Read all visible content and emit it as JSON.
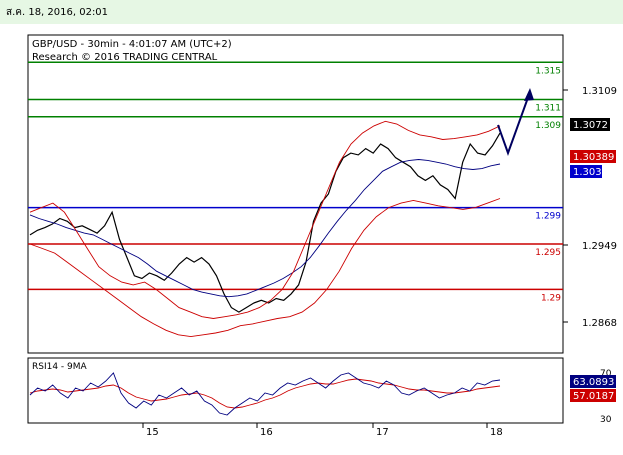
{
  "header": {
    "date": "ส.ค. 18, 2016, 02:01"
  },
  "chart_data": {
    "type": "line",
    "title": "GBP/USD - 30min - 4:01:07 AM (UTC+2)",
    "subtitle": "Research © 2016 TRADING CENTRAL",
    "x_ticks": [
      "15",
      "16",
      "17",
      "18"
    ],
    "y_ticks": [
      "1.3109",
      "1.2949",
      "1.2868"
    ],
    "ylim": [
      1.283,
      1.318
    ],
    "levels": [
      {
        "label": "1.315",
        "value": 1.315,
        "color": "#008000"
      },
      {
        "label": "1.311",
        "value": 1.3109,
        "color": "#008000"
      },
      {
        "label": "1.309",
        "value": 1.309,
        "color": "#008000"
      },
      {
        "label": "1.299",
        "value": 1.299,
        "color": "#0000cc"
      },
      {
        "label": "1.295",
        "value": 1.295,
        "color": "#cc0000"
      },
      {
        "label": "1.29",
        "value": 1.29,
        "color": "#cc0000"
      }
    ],
    "price_tags": [
      {
        "label": "1.3072",
        "bg": "#000000"
      },
      {
        "label": "1.30389",
        "bg": "#cc0000"
      },
      {
        "label": "1.303",
        "bg": "#0000cc"
      }
    ],
    "series": [
      {
        "color": "#000000",
        "values": [
          1.296,
          1.2965,
          1.2968,
          1.2972,
          1.2978,
          1.2975,
          1.2968,
          1.297,
          1.2966,
          1.2962,
          1.297,
          1.2985,
          1.2955,
          1.2935,
          1.2915,
          1.2912,
          1.2918,
          1.2915,
          1.291,
          1.2918,
          1.2928,
          1.2935,
          1.293,
          1.2935,
          1.2928,
          1.2915,
          1.2895,
          1.288,
          1.2875,
          1.288,
          1.2885,
          1.2888,
          1.2885,
          1.289,
          1.2888,
          1.2895,
          1.2905,
          1.293,
          1.2975,
          1.2995,
          1.3005,
          1.303,
          1.3045,
          1.305,
          1.3048,
          1.3055,
          1.305,
          1.306,
          1.3055,
          1.3045,
          1.304,
          1.3035,
          1.3025,
          1.302,
          1.3025,
          1.3015,
          1.301,
          1.3,
          1.304,
          1.306,
          1.305,
          1.3048,
          1.3058,
          1.3072
        ]
      },
      {
        "color": "#000080",
        "values": [
          1.2982,
          1.2978,
          1.2975,
          1.2972,
          1.2968,
          1.2965,
          1.2962,
          1.296,
          1.2955,
          1.295,
          1.2945,
          1.294,
          1.2935,
          1.2928,
          1.292,
          1.2915,
          1.291,
          1.2905,
          1.29,
          1.2897,
          1.2895,
          1.2893,
          1.2892,
          1.2893,
          1.2895,
          1.2899,
          1.2903,
          1.2907,
          1.2912,
          1.2918,
          1.2925,
          1.2935,
          1.2948,
          1.2962,
          1.2975,
          1.2987,
          1.2998,
          1.301,
          1.302,
          1.303,
          1.3035,
          1.304,
          1.3042,
          1.3043,
          1.3042,
          1.304,
          1.3038,
          1.3035,
          1.3033,
          1.3032,
          1.3033,
          1.3036,
          1.3038
        ]
      },
      {
        "color": "#cc0000",
        "values": [
          1.2985,
          1.299,
          1.2995,
          1.2985,
          1.2965,
          1.2945,
          1.2925,
          1.2915,
          1.2908,
          1.2905,
          1.2908,
          1.29,
          1.289,
          1.288,
          1.2875,
          1.287,
          1.2868,
          1.287,
          1.2872,
          1.2875,
          1.288,
          1.2888,
          1.29,
          1.292,
          1.295,
          1.298,
          1.301,
          1.304,
          1.306,
          1.3072,
          1.308,
          1.3085,
          1.3082,
          1.3075,
          1.307,
          1.3068,
          1.3065,
          1.3066,
          1.3068,
          1.307,
          1.3074,
          1.308
        ]
      },
      {
        "color": "#cc0000",
        "values": [
          1.295,
          1.2945,
          1.294,
          1.293,
          1.292,
          1.291,
          1.29,
          1.289,
          1.288,
          1.287,
          1.2862,
          1.2855,
          1.285,
          1.2848,
          1.285,
          1.2852,
          1.2855,
          1.286,
          1.2862,
          1.2865,
          1.2868,
          1.287,
          1.2875,
          1.2885,
          1.29,
          1.292,
          1.2945,
          1.2965,
          1.298,
          1.299,
          1.2995,
          1.2998,
          1.2995,
          1.2992,
          1.299,
          1.2988,
          1.299,
          1.2995,
          1.3
        ]
      }
    ],
    "rsi": {
      "title": "RSI14 - 9MA",
      "y_ticks": [
        "70",
        "30"
      ],
      "ylim": [
        20,
        85
      ],
      "tags": [
        {
          "label": "63.0893",
          "bg": "#000080"
        },
        {
          "label": "57.0187",
          "bg": "#cc0000"
        }
      ],
      "rsi_values": [
        48,
        55,
        52,
        58,
        50,
        45,
        55,
        52,
        60,
        56,
        62,
        70,
        50,
        40,
        35,
        42,
        38,
        48,
        45,
        50,
        55,
        48,
        52,
        42,
        38,
        30,
        28,
        35,
        40,
        45,
        42,
        50,
        48,
        55,
        60,
        58,
        62,
        65,
        60,
        55,
        62,
        68,
        70,
        65,
        60,
        58,
        55,
        62,
        58,
        50,
        48,
        52,
        55,
        50,
        45,
        48,
        50,
        55,
        52,
        60,
        58,
        62,
        63
      ],
      "ma_values": [
        50,
        52,
        53,
        54,
        53,
        51,
        52,
        53,
        54,
        55,
        57,
        58,
        55,
        50,
        46,
        44,
        42,
        43,
        44,
        46,
        48,
        49,
        50,
        48,
        45,
        40,
        36,
        35,
        36,
        38,
        40,
        43,
        45,
        48,
        52,
        55,
        57,
        59,
        60,
        59,
        59,
        61,
        63,
        64,
        63,
        62,
        60,
        59,
        58,
        56,
        54,
        53,
        53,
        52,
        51,
        50,
        50,
        51,
        52,
        54,
        55,
        56,
        57
      ]
    },
    "forecast_arrow": {
      "color": "#000060"
    }
  }
}
